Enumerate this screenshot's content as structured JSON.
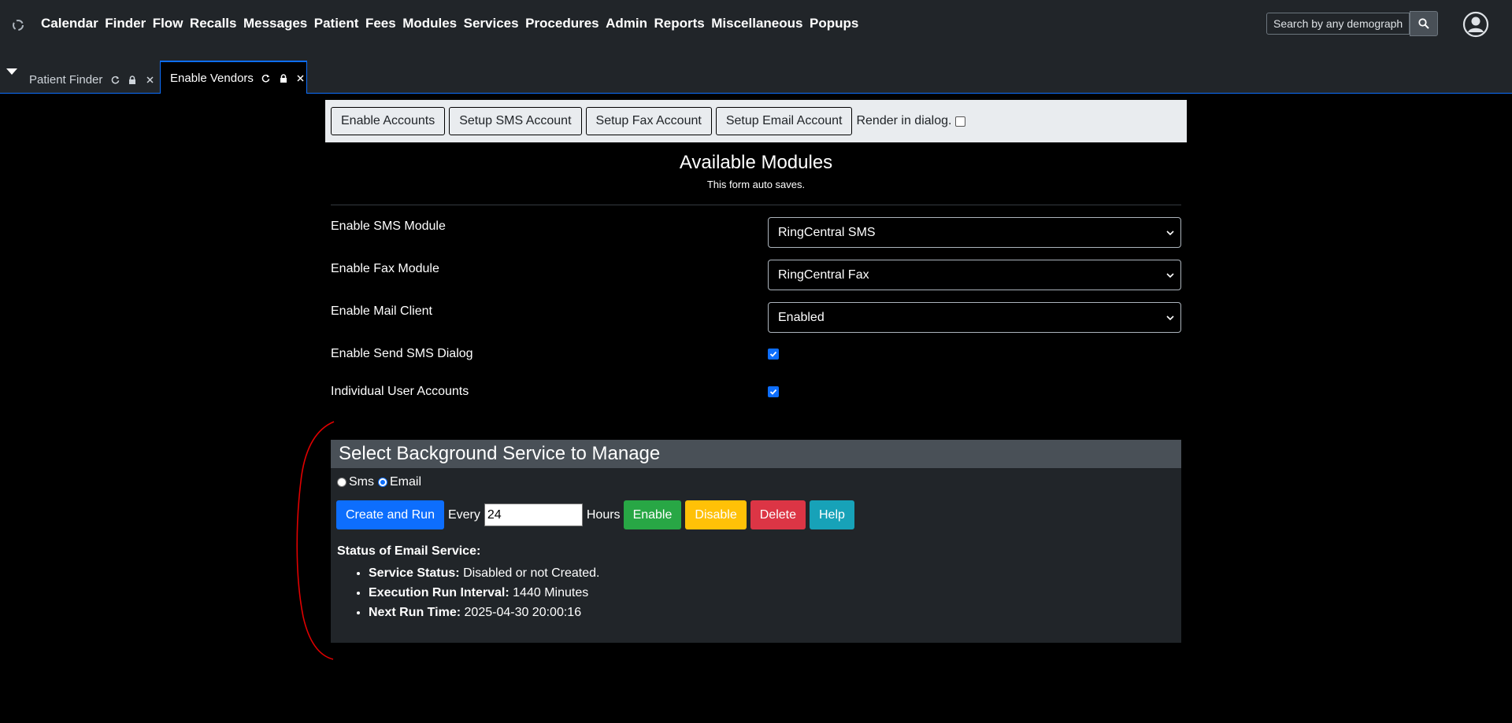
{
  "nav": {
    "menu": [
      "Calendar",
      "Finder",
      "Flow",
      "Recalls",
      "Messages",
      "Patient",
      "Fees",
      "Modules",
      "Services",
      "Procedures",
      "Admin",
      "Reports",
      "Miscellaneous",
      "Popups"
    ],
    "search_placeholder": "Search by any demographics"
  },
  "tabs": [
    {
      "label": "Patient Finder",
      "active": false
    },
    {
      "label": "Enable Vendors",
      "active": true
    }
  ],
  "toolbar": {
    "enable_accounts": "Enable Accounts",
    "setup_sms": "Setup SMS Account",
    "setup_fax": "Setup Fax Account",
    "setup_email": "Setup Email Account",
    "render_in_dialog": "Render in dialog.",
    "render_in_dialog_checked": false
  },
  "modules": {
    "title": "Available Modules",
    "subtitle": "This form auto saves.",
    "rows": [
      {
        "label": "Enable SMS Module",
        "value": "RingCentral SMS"
      },
      {
        "label": "Enable Fax Module",
        "value": "RingCentral Fax"
      },
      {
        "label": "Enable Mail Client",
        "value": "Enabled"
      },
      {
        "label": "Enable Send SMS Dialog",
        "checked": true
      },
      {
        "label": "Individual User Accounts",
        "checked": true
      }
    ]
  },
  "background_service": {
    "title": "Select Background Service to Manage",
    "radio_sms": "Sms",
    "radio_email": "Email",
    "selected": "Email",
    "create_and_run": "Create and Run",
    "every_label": "Every",
    "interval_value": "24",
    "hours_label": "Hours",
    "enable": "Enable",
    "disable": "Disable",
    "delete": "Delete",
    "help": "Help",
    "status_title": "Status of Email Service:",
    "status": [
      {
        "label": "Service Status:",
        "value": "Disabled or not Created."
      },
      {
        "label": "Execution Run Interval:",
        "value": "1440 Minutes"
      },
      {
        "label": "Next Run Time:",
        "value": "2025-04-30 20:00:16"
      }
    ]
  },
  "colors": {
    "primary": "#0d6efd",
    "success": "#28a745",
    "warning": "#ffc107",
    "danger": "#dc3545",
    "info": "#17a2b8",
    "annotation": "#e00000"
  }
}
